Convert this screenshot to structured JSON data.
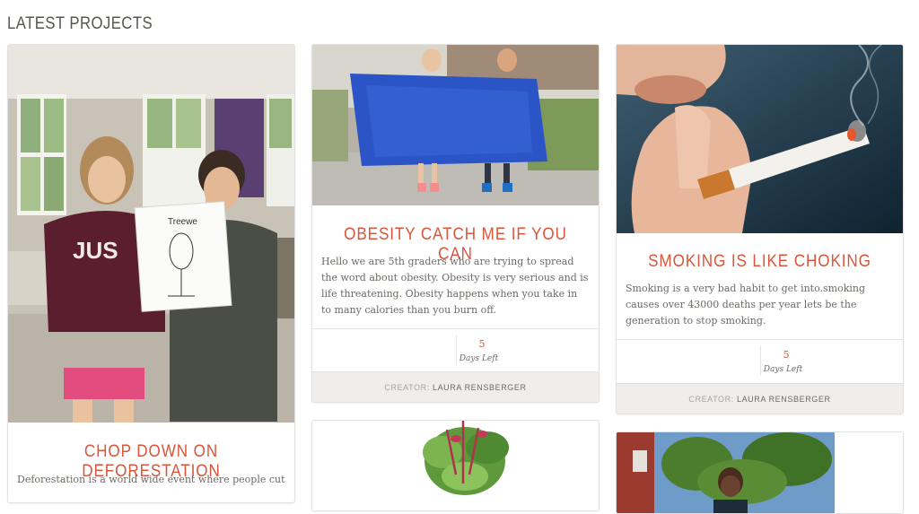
{
  "section": {
    "title": "LATEST PROJECTS"
  },
  "colors": {
    "accent": "#d9563a",
    "text": "#6e6964",
    "footer_bg": "#efeeed"
  },
  "projects": [
    {
      "title": "CHOP DOWN ON DEFORESTATION",
      "description": "Deforestation is a world wide event where people cut",
      "image": "two-students-holding-tree-drawing-photo",
      "drawing_text": "Treewe"
    },
    {
      "title": "OBESITY CATCH ME IF YOU CAN",
      "description": "Hello we are 5th graders who are trying to spread the word about obesity. Obesity is very serious and is life threatening. Obesity happens when you take in to many calories than you burn off.",
      "image": "students-holding-blue-banner-photo",
      "days_left": "5",
      "days_left_label": "Days Left",
      "creator_label": "CREATOR:",
      "creator_name": "LAURA RENSBERGER"
    },
    {
      "title": "SMOKING IS LIKE CHOKING",
      "description": "Smoking is a very bad habit to get into.smoking causes over 43000 deaths per year lets be the generation to stop smoking.",
      "image": "hand-holding-cigarette-photo",
      "days_left": "5",
      "days_left_label": "Days Left",
      "creator_label": "CREATOR:",
      "creator_name": "LAURA RENSBERGER"
    },
    {
      "image": "leafy-plant-photo"
    },
    {
      "image": "student-outdoors-trees-photo"
    }
  ]
}
